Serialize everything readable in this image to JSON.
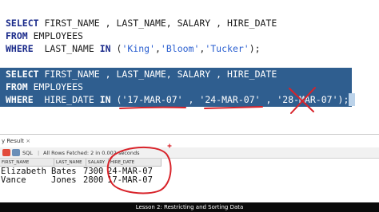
{
  "editor": {
    "query1": {
      "l1_kw": "SELECT",
      "l1_rest": " FIRST_NAME , LAST_NAME, SALARY , HIRE_DATE",
      "l2_kw": "FROM",
      "l2_rest": " EMPLOYEES",
      "l3_kw": "WHERE",
      "l3_a": "  LAST_NAME ",
      "l3_in": "IN",
      "l3_b": " (",
      "l3_s1": "'King'",
      "l3_c1": ",",
      "l3_s2": "'Bloom'",
      "l3_c2": ",",
      "l3_s3": "'Tucker'",
      "l3_end": ");"
    },
    "query2": {
      "l1_kw": "SELECT",
      "l1_rest": " FIRST_NAME , LAST_NAME, SALARY , HIRE_DATE",
      "l2_kw": "FROM",
      "l2_rest": " EMPLOYEES",
      "l3_kw": "WHERE",
      "l3_a": "  HIRE_DATE ",
      "l3_in": "IN",
      "l3_b": " (",
      "l3_s1": "'17-MAR-07'",
      "l3_c1": " , ",
      "l3_s2": "'24-MAR-07'",
      "l3_c2": " , ",
      "l3_s3": "'28-MAR-07'",
      "l3_end": ");"
    }
  },
  "results": {
    "tab_label": "y Result",
    "tab_close": "×",
    "toolbar": {
      "sql_label": "SQL",
      "status": "All Rows Fetched: 2 in 0.002 seconds"
    },
    "columns": [
      "FIRST_NAME",
      "LAST_NAME",
      "SALARY",
      "HIRE_DATE"
    ],
    "rows": [
      {
        "first_name": "Elizabeth",
        "last_name": "Bates",
        "salary": "7300",
        "hire_date": "24-MAR-07"
      },
      {
        "first_name": "Vance",
        "last_name": "Jones",
        "salary": "2800",
        "hire_date": "17-MAR-07"
      }
    ]
  },
  "caption": {
    "text": "Lesson 2: Restricting and Sorting Data"
  },
  "colors": {
    "selection": "#2f5e8f",
    "annotation": "#d8232a",
    "keyword": "#1a2a8a",
    "string": "#2a5fd0"
  }
}
